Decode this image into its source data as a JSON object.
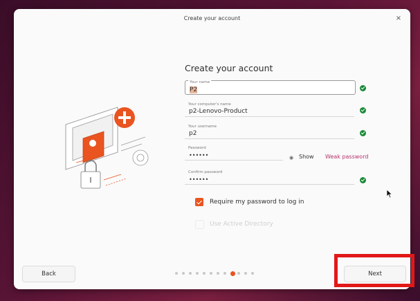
{
  "window": {
    "title": "Create your account",
    "close_glyph": "×"
  },
  "form": {
    "heading": "Create your account",
    "your_name": {
      "label": "Your name",
      "value": "P2"
    },
    "computer_name": {
      "label": "Your computer's name",
      "value": "p2-Lenovo-Product"
    },
    "username": {
      "label": "Your username",
      "value": "p2"
    },
    "password": {
      "label": "Password",
      "value": "••••••",
      "show_label": "Show",
      "strength": "Weak password"
    },
    "confirm_password": {
      "label": "Confirm password",
      "value": "••••••"
    },
    "require_password": {
      "label": "Require my password to log in",
      "checked": true
    },
    "active_directory": {
      "label": "Use Active Directory",
      "checked": false,
      "enabled": false
    }
  },
  "nav": {
    "back_label": "Back",
    "next_label": "Next",
    "pages_total": 12,
    "current_page": 9
  },
  "colors": {
    "accent": "#e95420",
    "success": "#1b8a38",
    "weak": "#b5336b",
    "highlight": "#e21818"
  },
  "icons": [
    "close-icon",
    "check-icon",
    "eye-icon",
    "mouse-pointer-icon"
  ]
}
